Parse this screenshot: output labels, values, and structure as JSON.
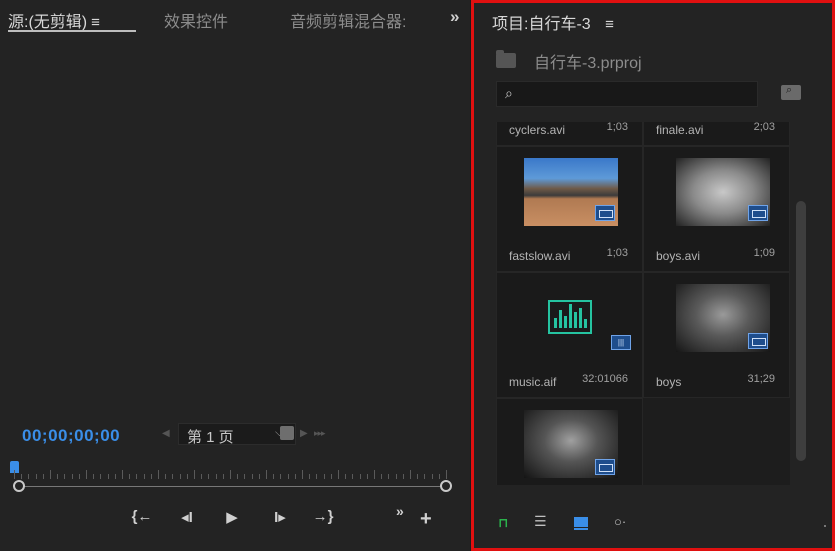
{
  "source_panel": {
    "tabs": [
      {
        "label": "源:(无剪辑)",
        "active": true
      },
      {
        "label": "效果控件",
        "active": false
      },
      {
        "label": "音频剪辑混合器:",
        "active": false
      }
    ],
    "menu_glyph": "≡",
    "overflow_glyph": "»",
    "timecode": "00;00;00;00",
    "page_select": "第 1 页",
    "transport": {
      "mark_in": "{←",
      "step_back": "◂I",
      "play": "▶",
      "step_forward": "I▸",
      "mark_out": "→}",
      "more": "»",
      "add": "+"
    }
  },
  "project_panel": {
    "title": "项目:自行车-3",
    "menu_glyph": "≡",
    "file_name": "自行车-3.prproj",
    "search": {
      "placeholder": "",
      "value": ""
    },
    "items": [
      {
        "name": "cyclers.avi",
        "duration": "1;03",
        "kind": "video"
      },
      {
        "name": "finale.avi",
        "duration": "2;03",
        "kind": "video"
      },
      {
        "name": "fastslow.avi",
        "duration": "1;03",
        "kind": "video"
      },
      {
        "name": "boys.avi",
        "duration": "1;09",
        "kind": "video"
      },
      {
        "name": "music.aif",
        "duration": "32:01066",
        "kind": "audio"
      },
      {
        "name": "boys",
        "duration": "31;29",
        "kind": "sequence"
      },
      {
        "name": "",
        "duration": "",
        "kind": "sequence"
      }
    ],
    "accent_color": "#3a8ee8",
    "highlight_border": "#e01010",
    "audio_color": "#25c3a0",
    "lock_color": "#2bb24c"
  }
}
